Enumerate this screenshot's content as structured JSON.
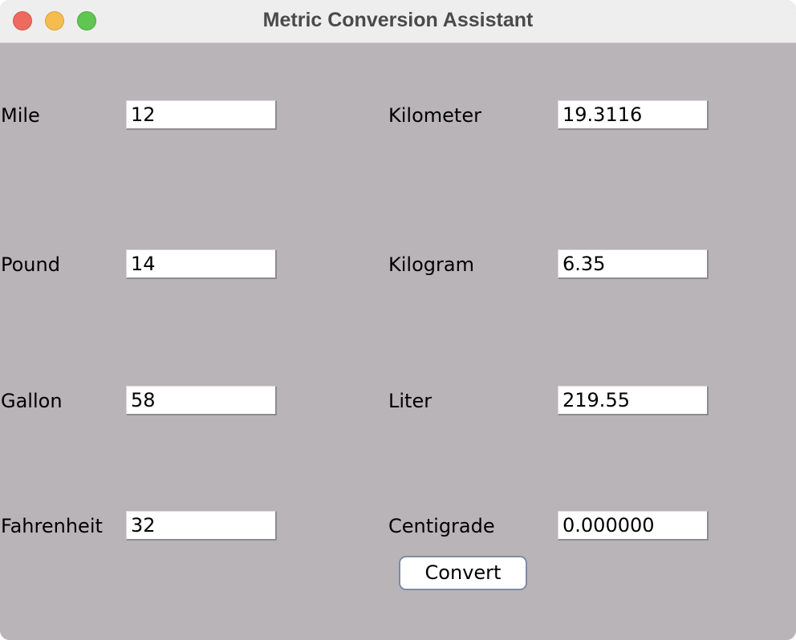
{
  "window": {
    "title": "Metric Conversion Assistant"
  },
  "rows": [
    {
      "left_label": "Mile",
      "left_value": "12",
      "right_label": "Kilometer",
      "right_value": "19.3116"
    },
    {
      "left_label": "Pound",
      "left_value": "14",
      "right_label": "Kilogram",
      "right_value": "6.35"
    },
    {
      "left_label": "Gallon",
      "left_value": "58",
      "right_label": "Liter",
      "right_value": "219.55"
    },
    {
      "left_label": "Fahrenheit",
      "left_value": "32",
      "right_label": "Centigrade",
      "right_value": "0.000000"
    }
  ],
  "actions": {
    "convert_label": "Convert"
  },
  "colors": {
    "window_background": "#b8b4b7",
    "titlebar_background": "#efeeee",
    "close": "#ee6a5f",
    "minimize": "#f5bd4f",
    "zoom": "#61c554"
  },
  "icons": {
    "close": "close-icon",
    "minimize": "minimize-icon",
    "zoom": "zoom-icon"
  }
}
